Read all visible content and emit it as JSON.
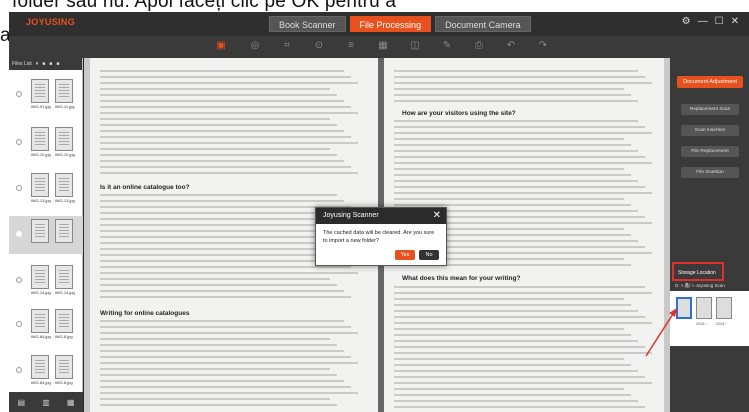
{
  "overlay_text": {
    "top": "folder sau nu. Apoi faceți clic pe OK pentru a",
    "left": "a"
  },
  "app": {
    "logo": "JOYUSING"
  },
  "tabs": [
    {
      "label": "Book Scanner"
    },
    {
      "label": "File Processing"
    },
    {
      "label": "Document Camera"
    }
  ],
  "window_controls": {
    "settings": "⚙",
    "minimize": "—",
    "maximize": "☐",
    "close": "✕"
  },
  "sidebar": {
    "header": "Files List",
    "rows": [
      {
        "left": "IMG-91.jpg",
        "right": "IMG-11.jpg"
      },
      {
        "left": "IMG-12.jpg",
        "right": "IMG-12.jpg"
      },
      {
        "left": "IMG-13.jpg",
        "right": "IMG-13.jpg"
      },
      {
        "left": "",
        "right": ""
      },
      {
        "left": "IMG-14.jpg",
        "right": "IMG-14.jpg"
      },
      {
        "left": "IMG-84.jpg",
        "right": "IMG-8.jpg"
      },
      {
        "left": "IMG-84.jpg",
        "right": "IMG-8.jpg"
      }
    ]
  },
  "document": {
    "left_page": {
      "heading1": "Is it an online catalogue too?",
      "heading2": "Writing for online catalogues"
    },
    "right_page": {
      "heading1": "How are your visitors using the site?",
      "heading2": "What does this mean for your writing?"
    }
  },
  "dialog": {
    "title": "Joyusing Scanner",
    "message": "The cached data will be cleared. Are you sure to import a new folder?",
    "yes": "Yes",
    "no": "No"
  },
  "right_panel": {
    "header": "Document Adjustment",
    "buttons": [
      "Replacement Scan",
      "Scan Insertion",
      "File Replacement",
      "File Insertion"
    ],
    "storage_label": "Storage Location",
    "path": "D: > 鑫/ > Joyusing Scan",
    "thumbs": [
      "",
      "2021~",
      "2021~"
    ]
  },
  "colors": {
    "accent": "#e8511e",
    "highlight_red": "#e0302a"
  }
}
